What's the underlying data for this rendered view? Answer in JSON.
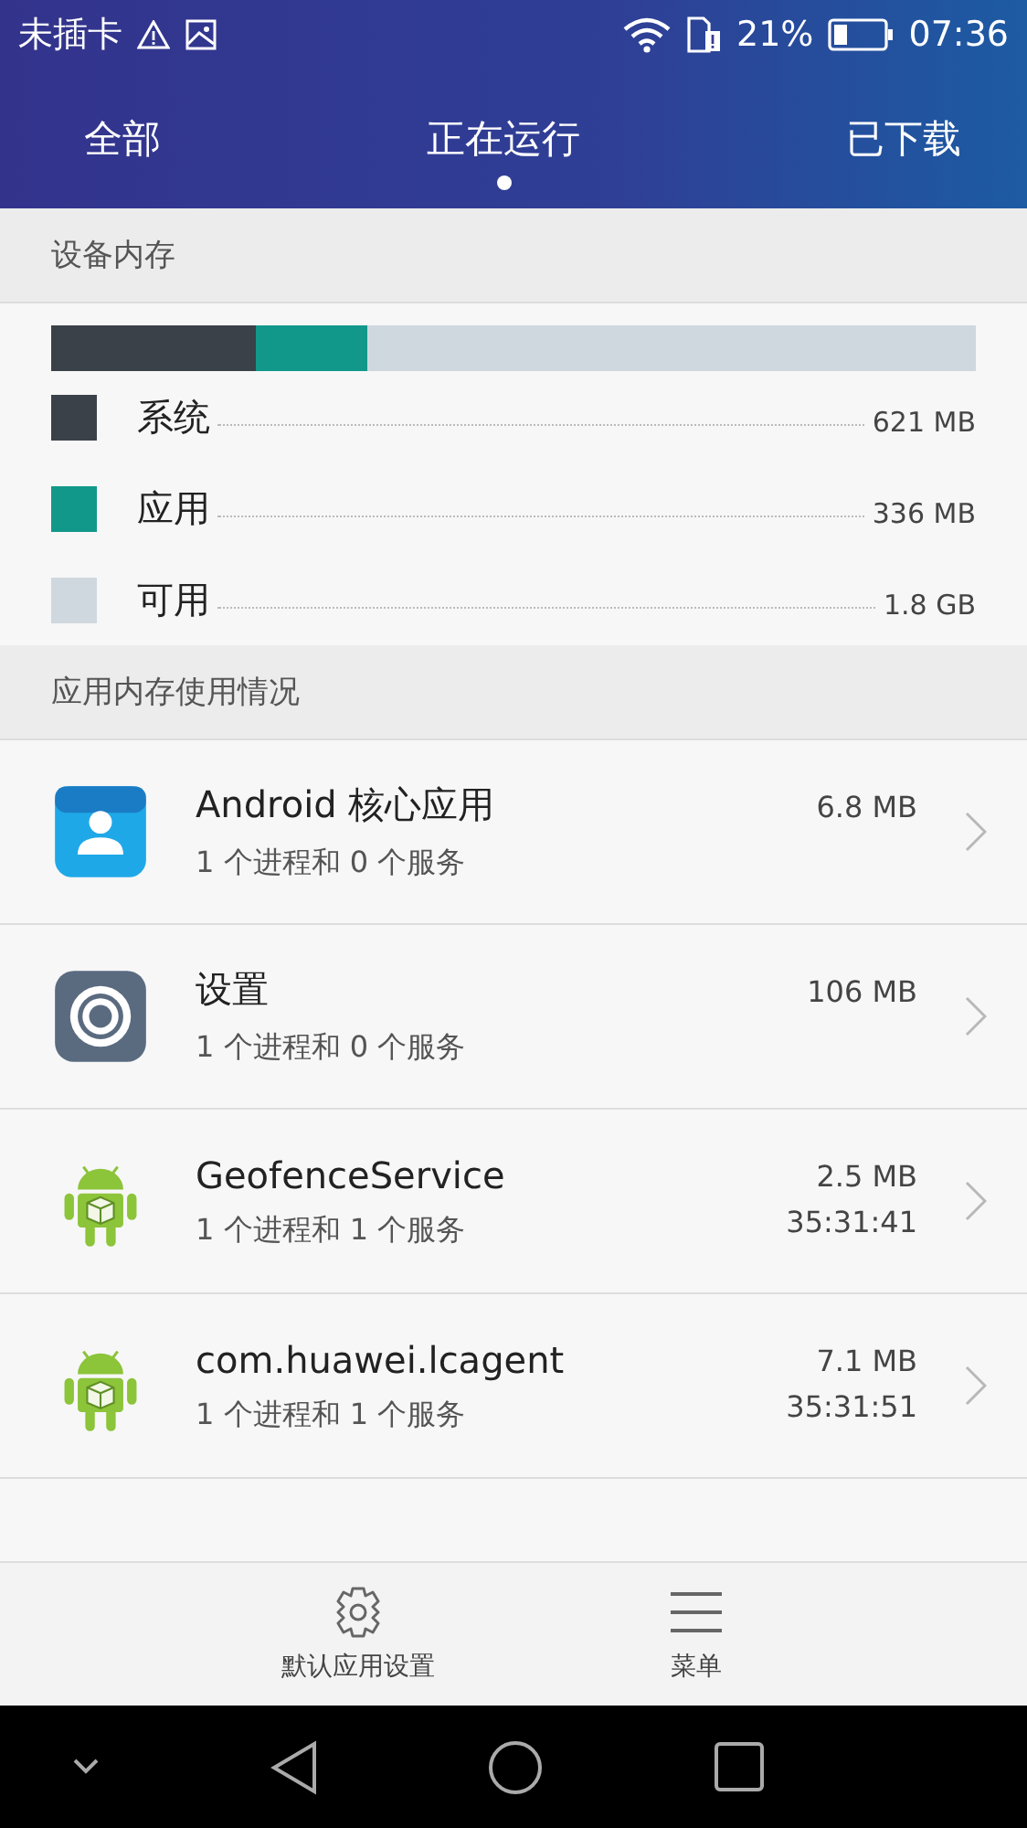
{
  "status_bar": {
    "carrier": "未插卡",
    "battery_text": "21%",
    "time": "07:36"
  },
  "tabs": [
    {
      "label": "全部",
      "selected": false
    },
    {
      "label": "正在运行",
      "selected": true
    },
    {
      "label": "已下载",
      "selected": false
    }
  ],
  "device_memory": {
    "title": "设备内存",
    "segments": [
      {
        "label": "系统",
        "value": "621 MB",
        "color": "#3a4149"
      },
      {
        "label": "应用",
        "value": "336 MB",
        "color": "#12988a"
      },
      {
        "label": "可用",
        "value": "1.8 GB",
        "color": "#cfd8de"
      }
    ]
  },
  "app_memory": {
    "title": "应用内存使用情况",
    "apps": [
      {
        "kind": "contacts",
        "name": "Android 核心应用",
        "detail": "1 个进程和 0 个服务",
        "size": "6.8 MB"
      },
      {
        "kind": "settings",
        "name": "设置",
        "detail": "1 个进程和 0 个服务",
        "size": "106 MB"
      },
      {
        "kind": "android",
        "name": "GeofenceService",
        "detail": "1 个进程和 1 个服务",
        "size": "2.5 MB",
        "time": "35:31:41"
      },
      {
        "kind": "android",
        "name": "com.huawei.lcagent",
        "detail": "1 个进程和 1 个服务",
        "size": "7.1 MB",
        "time": "35:31:51"
      }
    ]
  },
  "bottom_bar": [
    {
      "kind": "settings",
      "label": "默认应用设置"
    },
    {
      "kind": "menu",
      "label": "菜单"
    }
  ]
}
